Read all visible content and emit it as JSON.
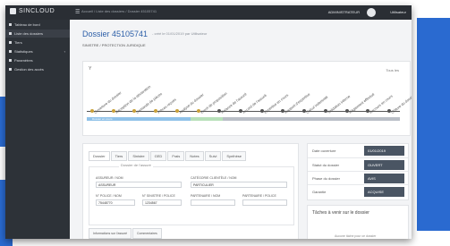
{
  "app": {
    "brand": "SINCLOUD"
  },
  "topbar": {
    "nav": "Accueil / Liste des dossiers / Dossier 45105741",
    "user_role": "ADMINISTRATEUR",
    "user_name": "Utilisateur"
  },
  "sidebar": {
    "items": [
      {
        "label": "Tableau de bord"
      },
      {
        "label": "Liste des dossiers"
      },
      {
        "label": "Tiers"
      },
      {
        "label": "Statistiques"
      },
      {
        "label": "Paramètres"
      },
      {
        "label": "Gestion des accès"
      }
    ]
  },
  "page": {
    "title": "Dossier 45105741",
    "subtitle": "- créé le 01/01/2019 par Utilisateur",
    "description": "SINISTRE / PROTECTION JURIDIQUE"
  },
  "timeline": {
    "filter_label": "Y",
    "top_right": "Tous les",
    "steps": [
      "Ouverture du dossier",
      "Réception de la déclaration",
      "Demande de pièces",
      "Pièces reçues",
      "Analyse du dossier",
      "Envoi de proposition",
      "Relance de l'assuré",
      "Accord de l'assuré",
      "Expertise en cours",
      "Rapport d'expertise",
      "Calcul indemnité",
      "Validation interne",
      "Règlement effectué",
      "Recours en cours",
      "Clôture du dossier"
    ],
    "bar_label": "Dossier en cours",
    "colors": {
      "line": "#555555",
      "done": "#8fc1e8",
      "progress": "#b7e0b9",
      "todo": "#b9bec6"
    }
  },
  "details": {
    "tabs": [
      "Dossier",
      "Tiers",
      "Sinistre",
      "GED",
      "Frais",
      "Notes",
      "Suivi",
      "Synthèse"
    ],
    "legend": "Dossier de l'assuré",
    "fields": [
      {
        "label": "ASSUREUR / NOM",
        "value": "ASSUREUR"
      },
      {
        "label": "CATÉGORIE CLIENTÈLE / NOM",
        "value": "PARTICULIER"
      },
      {
        "label": "N° POLICE / NOM",
        "value": "75448770"
      },
      {
        "label": "N° SINISTRE / POLICE",
        "value": "1234567"
      },
      {
        "label": "PARTENAIRE / NOM",
        "value": ""
      },
      {
        "label": "PARTENAIRE / POLICE",
        "value": ""
      }
    ],
    "subtabs": [
      "Informations sur l'assuré",
      "Commentaires"
    ]
  },
  "status": {
    "rows": [
      {
        "label": "Date ouverture",
        "value": "01/01/2019"
      },
      {
        "label": "Statut du dossier",
        "value": "OUVERT"
      },
      {
        "label": "Phase du dossier",
        "value": "AVIS"
      },
      {
        "label": "Garantie",
        "value": "ACQUISE"
      }
    ]
  },
  "tasks": {
    "title": "Tâches à venir sur le dossier",
    "empty": "Aucune tâche pour ce dossier"
  }
}
